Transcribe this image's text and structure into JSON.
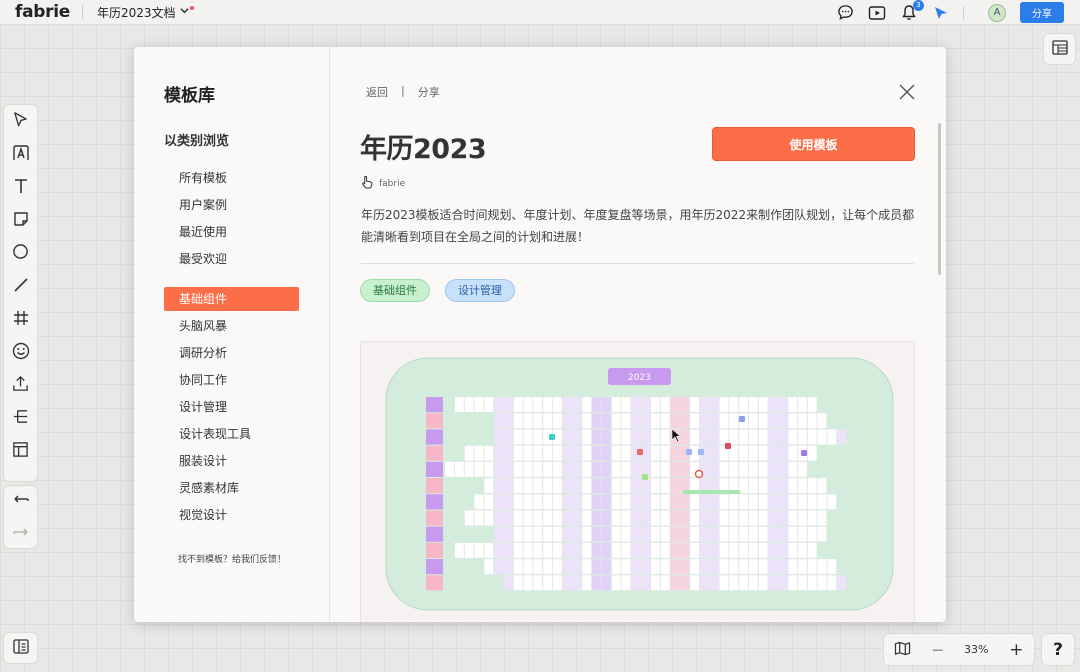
{
  "app": {
    "logo": "fabrie",
    "doc_title": "年历2023文档",
    "share_label": "分享",
    "avatar_letter": "A",
    "notification_count": "3"
  },
  "zoom": {
    "level": "33%",
    "minus": "—",
    "plus": "+"
  },
  "help_label": "?",
  "modal": {
    "side_title": "模板库",
    "side_subtitle": "以类别浏览",
    "categories": [
      {
        "label": "所有模板"
      },
      {
        "label": "用户案例"
      },
      {
        "label": "最近使用"
      },
      {
        "label": "最受欢迎"
      },
      {
        "label": "基础组件"
      },
      {
        "label": "头脑风暴"
      },
      {
        "label": "调研分析"
      },
      {
        "label": "协同工作"
      },
      {
        "label": "设计管理"
      },
      {
        "label": "设计表现工具"
      },
      {
        "label": "服装设计"
      },
      {
        "label": "灵感素材库"
      },
      {
        "label": "视觉设计"
      }
    ],
    "active_category": "基础组件",
    "feedback_text": "找不到模板？给我们反馈！",
    "back_label": "返回",
    "crumb_sep": "|",
    "share_label": "分享",
    "template_title": "年历2023",
    "use_button": "使用模板",
    "author": "fabrie",
    "description": "年历2023模板适合时间规划、年度计划、年度复盘等场景，用年历2022来制作团队规划，让每个成员都能清晰看到项目在全局之间的计划和进展！",
    "tags": [
      {
        "label": "基础组件"
      },
      {
        "label": "设计管理"
      }
    ],
    "preview": {
      "year_label": "2023"
    }
  },
  "colors": {
    "accent": "#fb6e47",
    "primary_blue": "#2b7de9",
    "preview_bg": "#d4ecdc",
    "month_label": "#c79af0"
  }
}
